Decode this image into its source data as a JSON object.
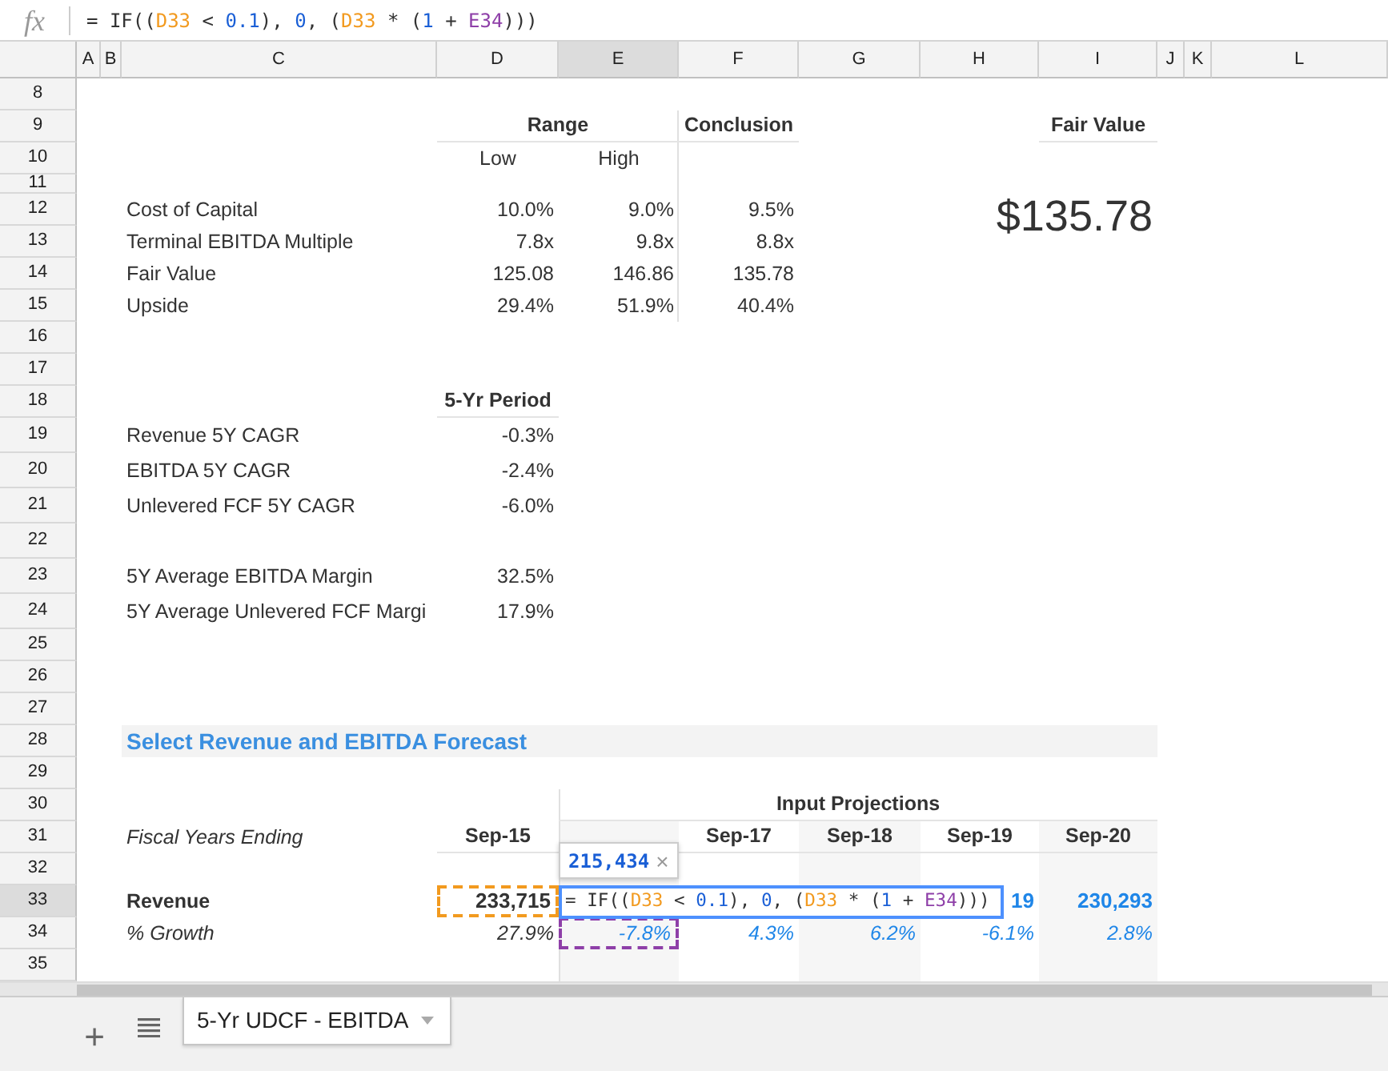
{
  "formula_bar": {
    "label": "fx",
    "tokens": [
      {
        "text": "= IF((",
        "kind": "text"
      },
      {
        "text": "D33",
        "kind": "ref",
        "color": "#f29a1f"
      },
      {
        "text": " < ",
        "kind": "text"
      },
      {
        "text": "0.1",
        "kind": "number"
      },
      {
        "text": "), ",
        "kind": "text"
      },
      {
        "text": "0",
        "kind": "number"
      },
      {
        "text": ", (",
        "kind": "text"
      },
      {
        "text": "D33",
        "kind": "ref",
        "color": "#f29a1f"
      },
      {
        "text": " * (",
        "kind": "text"
      },
      {
        "text": "1",
        "kind": "number"
      },
      {
        "text": " + ",
        "kind": "text"
      },
      {
        "text": "E34",
        "kind": "ref",
        "color": "#8e3fa8"
      },
      {
        "text": ")))",
        "kind": "text"
      }
    ]
  },
  "columns": [
    {
      "label": "A",
      "selected": false
    },
    {
      "label": "B",
      "selected": false
    },
    {
      "label": "C",
      "selected": false
    },
    {
      "label": "D",
      "selected": false
    },
    {
      "label": "E",
      "selected": true
    },
    {
      "label": "F",
      "selected": false
    },
    {
      "label": "G",
      "selected": false
    },
    {
      "label": "H",
      "selected": false
    },
    {
      "label": "I",
      "selected": false
    },
    {
      "label": "J",
      "selected": false
    },
    {
      "label": "K",
      "selected": false
    },
    {
      "label": "L",
      "selected": false
    }
  ],
  "rows": [
    {
      "label": "8",
      "selected": false
    },
    {
      "label": "9",
      "selected": false,
      "cells": {
        "D": {
          "text": "Range",
          "kind": "group-header"
        },
        "F": {
          "text": "Conclusion",
          "kind": "header"
        },
        "I": {
          "text": "Fair Value",
          "kind": "header"
        }
      }
    },
    {
      "label": "10",
      "selected": false,
      "cells": {
        "D": {
          "text": "Low",
          "kind": "subheader"
        },
        "E": {
          "text": "High",
          "kind": "subheader"
        }
      }
    },
    {
      "label": "11",
      "selected": false
    },
    {
      "label": "12",
      "selected": false,
      "cells": {
        "C": {
          "text": "Cost of Capital",
          "kind": "label"
        },
        "D": {
          "text": "10.0%",
          "kind": "value"
        },
        "E": {
          "text": "9.0%",
          "kind": "value"
        },
        "F": {
          "text": "9.5%",
          "kind": "value"
        },
        "I": {
          "text": "$135.78",
          "kind": "big"
        }
      }
    },
    {
      "label": "13",
      "selected": false,
      "cells": {
        "C": {
          "text": "Terminal EBITDA Multiple",
          "kind": "label"
        },
        "D": {
          "text": "7.8x",
          "kind": "value"
        },
        "E": {
          "text": "9.8x",
          "kind": "value"
        },
        "F": {
          "text": "8.8x",
          "kind": "value"
        }
      }
    },
    {
      "label": "14",
      "selected": false,
      "cells": {
        "C": {
          "text": "Fair Value",
          "kind": "label"
        },
        "D": {
          "text": "125.08",
          "kind": "value"
        },
        "E": {
          "text": "146.86",
          "kind": "value"
        },
        "F": {
          "text": "135.78",
          "kind": "value"
        }
      }
    },
    {
      "label": "15",
      "selected": false,
      "cells": {
        "C": {
          "text": "Upside",
          "kind": "label"
        },
        "D": {
          "text": "29.4%",
          "kind": "value"
        },
        "E": {
          "text": "51.9%",
          "kind": "value"
        },
        "F": {
          "text": "40.4%",
          "kind": "value"
        }
      }
    },
    {
      "label": "16",
      "selected": false
    },
    {
      "label": "17",
      "selected": false
    },
    {
      "label": "18",
      "selected": false,
      "cells": {
        "D": {
          "text": "5-Yr Period",
          "kind": "header"
        }
      }
    },
    {
      "label": "19",
      "selected": false,
      "cells": {
        "C": {
          "text": "Revenue 5Y CAGR",
          "kind": "label"
        },
        "D": {
          "text": "-0.3%",
          "kind": "value"
        }
      }
    },
    {
      "label": "20",
      "selected": false,
      "cells": {
        "C": {
          "text": "EBITDA 5Y CAGR",
          "kind": "label"
        },
        "D": {
          "text": "-2.4%",
          "kind": "value"
        }
      }
    },
    {
      "label": "21",
      "selected": false,
      "cells": {
        "C": {
          "text": "Unlevered FCF 5Y CAGR",
          "kind": "label"
        },
        "D": {
          "text": "-6.0%",
          "kind": "value"
        }
      }
    },
    {
      "label": "22",
      "selected": false
    },
    {
      "label": "23",
      "selected": false,
      "cells": {
        "C": {
          "text": "5Y Average EBITDA Margin",
          "kind": "label"
        },
        "D": {
          "text": "32.5%",
          "kind": "value"
        }
      }
    },
    {
      "label": "24",
      "selected": false,
      "cells": {
        "C": {
          "text": "5Y Average Unlevered FCF Margi",
          "kind": "label"
        },
        "D": {
          "text": "17.9%",
          "kind": "value"
        }
      }
    },
    {
      "label": "25",
      "selected": false
    },
    {
      "label": "26",
      "selected": false
    },
    {
      "label": "27",
      "selected": false
    },
    {
      "label": "28",
      "selected": false,
      "cells": {
        "C": {
          "text": "Select Revenue and EBITDA Forecast",
          "kind": "section"
        }
      }
    },
    {
      "label": "29",
      "selected": false
    },
    {
      "label": "30",
      "selected": false,
      "cells": {
        "E": {
          "text": "Input Projections",
          "kind": "group-header"
        }
      }
    },
    {
      "label": "31",
      "selected": false,
      "cells": {
        "C": {
          "text": "Fiscal Years Ending",
          "kind": "label-italic"
        },
        "D": {
          "text": "Sep-15",
          "kind": "header"
        },
        "F": {
          "text": "Sep-17",
          "kind": "header"
        },
        "G": {
          "text": "Sep-18",
          "kind": "header"
        },
        "H": {
          "text": "Sep-19",
          "kind": "header"
        },
        "I": {
          "text": "Sep-20",
          "kind": "header"
        }
      }
    },
    {
      "label": "32",
      "selected": false
    },
    {
      "label": "33",
      "selected": true,
      "cells": {
        "C": {
          "text": "Revenue",
          "kind": "label-bold"
        },
        "D": {
          "text": "233,715",
          "kind": "value-bold",
          "color": "#f29a1f"
        },
        "H": {
          "text": "19",
          "kind": "input-bold"
        },
        "I": {
          "text": "230,293",
          "kind": "input-bold"
        }
      }
    },
    {
      "label": "34",
      "selected": false,
      "cells": {
        "C": {
          "text": "% Growth",
          "kind": "label-italic"
        },
        "D": {
          "text": "27.9%",
          "kind": "value-italic"
        },
        "E": {
          "text": "-7.8%",
          "kind": "input-italic",
          "color": "#8e3fa8"
        },
        "F": {
          "text": "4.3%",
          "kind": "input-italic"
        },
        "G": {
          "text": "6.2%",
          "kind": "input-italic"
        },
        "H": {
          "text": "-6.1%",
          "kind": "input-italic"
        },
        "I": {
          "text": "2.8%",
          "kind": "input-italic"
        }
      }
    },
    {
      "label": "35",
      "selected": false
    }
  ],
  "tooltip": {
    "value": "215,434",
    "close": "×"
  },
  "editor": {
    "tokens": [
      {
        "text": "= IF((",
        "kind": "text"
      },
      {
        "text": "D33",
        "kind": "ref",
        "color": "#f29a1f"
      },
      {
        "text": " < ",
        "kind": "text"
      },
      {
        "text": "0.1",
        "kind": "number"
      },
      {
        "text": "), ",
        "kind": "text"
      },
      {
        "text": "0",
        "kind": "number"
      },
      {
        "text": ", (",
        "kind": "text"
      },
      {
        "text": "D33",
        "kind": "ref",
        "color": "#f29a1f"
      },
      {
        "text": " * (",
        "kind": "text"
      },
      {
        "text": "1",
        "kind": "number"
      },
      {
        "text": " + ",
        "kind": "text"
      },
      {
        "text": "E34",
        "kind": "ref",
        "color": "#8e3fa8"
      },
      {
        "text": ")))",
        "kind": "text"
      }
    ]
  },
  "sheet_bar": {
    "add": "+",
    "tabs": [
      {
        "label": "5-Yr UDCF - EBITDA",
        "selected": true
      }
    ]
  }
}
